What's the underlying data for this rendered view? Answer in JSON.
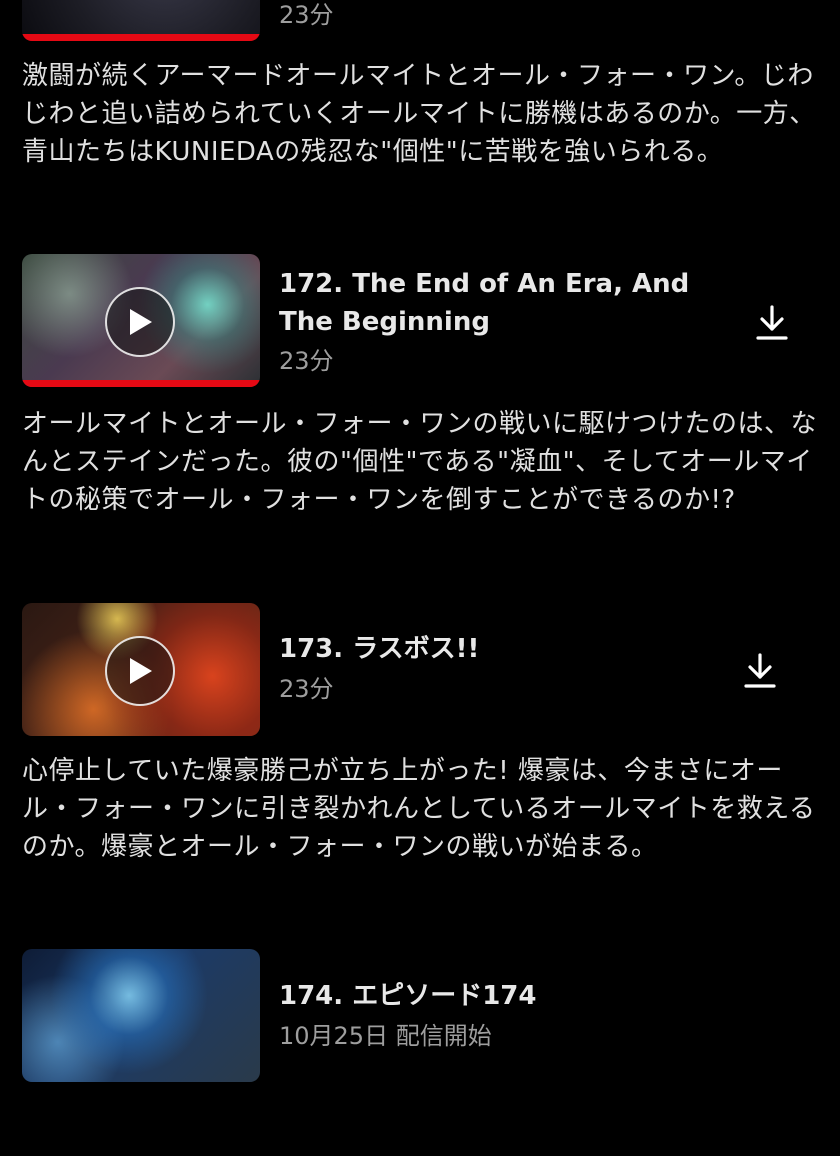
{
  "episodes": [
    {
      "duration": "23分",
      "description": "激闘が続くアーマードオールマイトとオール・フォー・ワン。じわじわと追い詰められていくオールマイトに勝機はあるのか。一方、青山たちはKUNIEDAの残忍な\"個性\"に苦戦を強いられる。",
      "progress": 1.0
    },
    {
      "title": "172. The End of An Era, And The Beginning",
      "duration": "23分",
      "description": "オールマイトとオール・フォー・ワンの戦いに駆けつけたのは、なんとステインだった。彼の\"個性\"である\"凝血\"、そしてオールマイトの秘策でオール・フォー・ワンを倒すことができるのか!?",
      "progress": 1.0,
      "icons": {
        "play": "play-icon",
        "download": "download-icon"
      }
    },
    {
      "title": "173. ラスボス!!",
      "duration": "23分",
      "description": "心停止していた爆豪勝己が立ち上がった! 爆豪は、今まさにオール・フォー・ワンに引き裂かれんとしているオールマイトを救えるのか。爆豪とオール・フォー・ワンの戦いが始まる。",
      "icons": {
        "play": "play-icon",
        "download": "download-icon"
      }
    },
    {
      "title": "174. エピソード174",
      "release": "10月25日 配信開始"
    }
  ],
  "colors": {
    "background": "#000000",
    "progress": "#e50914",
    "meta_text": "#9e9e9e"
  }
}
